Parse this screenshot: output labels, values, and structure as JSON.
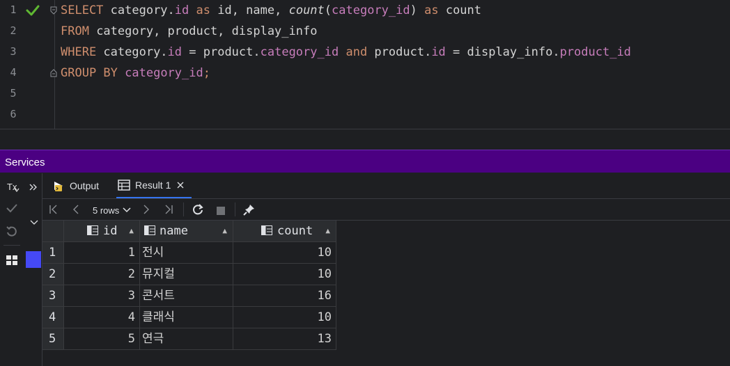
{
  "editor": {
    "line_numbers": [
      "1",
      "2",
      "3",
      "4",
      "5",
      "6"
    ],
    "lines": [
      [
        {
          "t": "SELECT",
          "c": "kw"
        },
        {
          "t": " category.",
          "c": "plain"
        },
        {
          "t": "id",
          "c": "fld"
        },
        {
          "t": " ",
          "c": "plain"
        },
        {
          "t": "as",
          "c": "kw"
        },
        {
          "t": " id, name, ",
          "c": "plain"
        },
        {
          "t": "count",
          "c": "fn"
        },
        {
          "t": "(",
          "c": "plain"
        },
        {
          "t": "category_id",
          "c": "fld"
        },
        {
          "t": ") ",
          "c": "plain"
        },
        {
          "t": "as",
          "c": "kw"
        },
        {
          "t": " count",
          "c": "plain"
        }
      ],
      [
        {
          "t": "FROM",
          "c": "kw"
        },
        {
          "t": " category, product, display_info",
          "c": "plain"
        }
      ],
      [
        {
          "t": "WHERE",
          "c": "kw"
        },
        {
          "t": " category.",
          "c": "plain"
        },
        {
          "t": "id",
          "c": "fld"
        },
        {
          "t": " = product.",
          "c": "plain"
        },
        {
          "t": "category_id",
          "c": "fld"
        },
        {
          "t": " ",
          "c": "plain"
        },
        {
          "t": "and",
          "c": "kw"
        },
        {
          "t": " product.",
          "c": "plain"
        },
        {
          "t": "id",
          "c": "fld"
        },
        {
          "t": " = display_info.",
          "c": "plain"
        },
        {
          "t": "product_id",
          "c": "fld"
        }
      ],
      [
        {
          "t": "GROUP BY",
          "c": "kw"
        },
        {
          "t": " ",
          "c": "plain"
        },
        {
          "t": "category_id",
          "c": "fld"
        },
        {
          "t": ";",
          "c": "kw"
        }
      ],
      [],
      []
    ]
  },
  "services": {
    "title": "Services"
  },
  "left_strip": {
    "tx_label": "Tx"
  },
  "tabs": [
    {
      "label": "Output"
    },
    {
      "label": "Result 1"
    }
  ],
  "toolbar": {
    "rows_label": "5 rows"
  },
  "table": {
    "columns": [
      "id",
      "name",
      "count"
    ],
    "rows": [
      {
        "n": "1",
        "id": "1",
        "name": "전시",
        "count": "10"
      },
      {
        "n": "2",
        "id": "2",
        "name": "뮤지컬",
        "count": "10"
      },
      {
        "n": "3",
        "id": "3",
        "name": "콘서트",
        "count": "16"
      },
      {
        "n": "4",
        "id": "4",
        "name": "클래식",
        "count": "10"
      },
      {
        "n": "5",
        "id": "5",
        "name": "연극",
        "count": "13"
      }
    ]
  },
  "colors": {
    "keyword": "#cf8e6d",
    "field": "#c77dbb",
    "services_bar": "#4b0082",
    "accent": "#3574f0",
    "check": "#5fb832"
  }
}
